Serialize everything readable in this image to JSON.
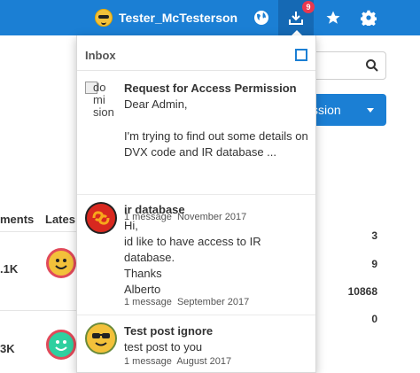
{
  "topbar": {
    "username": "Tester_McTesterson",
    "icons": [
      "globe-icon",
      "inbox-icon",
      "star-icon",
      "gear-icon"
    ],
    "inbox_badge": "9",
    "colors": {
      "bar": "#1b7fd4",
      "active": "#1569b4",
      "badge": "#e8384f"
    }
  },
  "background": {
    "button_label": "ssion",
    "table_headers": [
      "ments",
      "Lates"
    ],
    "row_values": [
      ".1K",
      "3K"
    ],
    "right_numbers": [
      "3",
      "9",
      "10868",
      "0"
    ]
  },
  "inbox": {
    "title": "Inbox",
    "mark_icon": "square-icon",
    "messages": [
      {
        "avatar_alt": "do mi sion",
        "title": "Request for Access Permission",
        "body": "Dear Admin,\n\nI'm trying to find out some details on DVX code and IR database ...",
        "count": "1 message",
        "date": "November 2017"
      },
      {
        "title": "ir database",
        "body": "Hi,\nid like to have access to IR database.\nThanks\nAlberto",
        "count": "1 message",
        "date": "September 2017"
      },
      {
        "title": "Test post ignore",
        "body": "test post to you",
        "count": "1 message",
        "date": "August 2017"
      }
    ]
  }
}
